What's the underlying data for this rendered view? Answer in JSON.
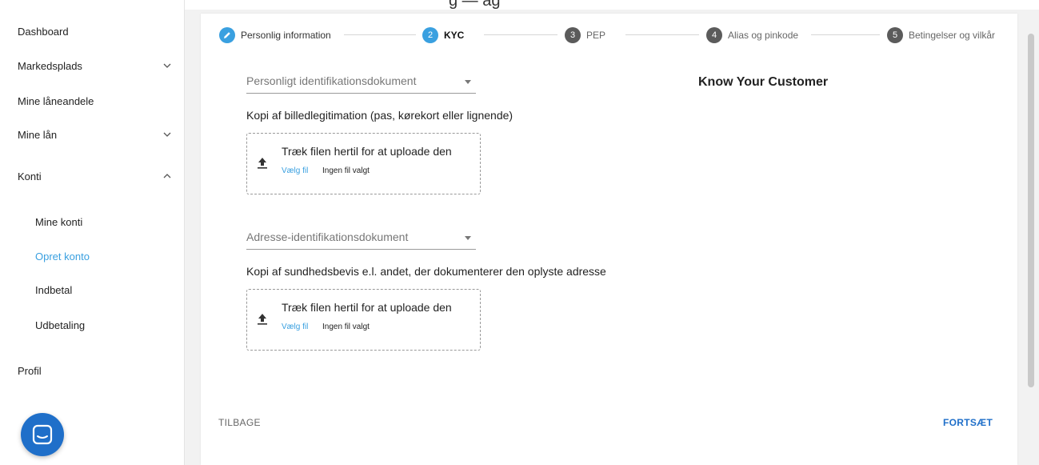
{
  "top_strip_text": "g — ag",
  "sidebar": {
    "items": [
      {
        "label": "Dashboard"
      },
      {
        "label": "Markedsplads"
      },
      {
        "label": "Mine låneandele"
      },
      {
        "label": "Mine lån"
      },
      {
        "label": "Konti"
      },
      {
        "label": "Profil"
      }
    ],
    "sub_items": [
      {
        "label": "Mine konti"
      },
      {
        "label": "Opret konto"
      },
      {
        "label": "Indbetal"
      },
      {
        "label": "Udbetaling"
      }
    ],
    "active_sub_item": "Opret konto"
  },
  "stepper": {
    "steps": [
      {
        "number": "",
        "label": "Personlig information",
        "state": "completed",
        "icon": "pencil-icon"
      },
      {
        "number": "2",
        "label": "KYC",
        "state": "active"
      },
      {
        "number": "3",
        "label": "PEP",
        "state": "pending"
      },
      {
        "number": "4",
        "label": "Alias og pinkode",
        "state": "pending"
      },
      {
        "number": "5",
        "label": "Betingelser og vilkår",
        "state": "pending"
      }
    ]
  },
  "main": {
    "title": "Know Your Customer",
    "id_select": {
      "value": "Personligt identifikationsdokument"
    },
    "id_label": "Kopi af billedlegitimation (pas, kørekort eller lignende)",
    "id_upload": {
      "title": "Træk filen hertil for at uploade den",
      "choose": "Vælg fil",
      "none": "Ingen fil valgt"
    },
    "address_select": {
      "value": "Adresse-identifikationsdokument"
    },
    "address_label": "Kopi af sundhedsbevis e.l. andet, der dokumenterer den oplyste adresse",
    "address_upload": {
      "title": "Træk filen hertil for at uploade den",
      "choose": "Vælg fil",
      "none": "Ingen fil valgt"
    }
  },
  "footer": {
    "back_label": "TILBAGE",
    "next_label": "FORTSÆT"
  },
  "colors": {
    "accent": "#3aa0e0",
    "primary": "#1f6fc9",
    "step_pending": "#5b5b5b"
  }
}
